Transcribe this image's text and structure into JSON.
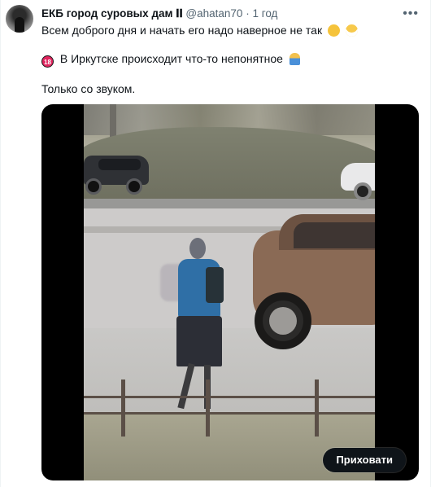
{
  "tweet": {
    "author_name": "ЕКБ город суровых дам 𝐈𝐈",
    "handle": "@ahatan70",
    "separator": "·",
    "time": "1 год",
    "line1": "Всем доброго дня и начать его надо наверное не так",
    "line2": "В Иркутске происходит что-то непонятное",
    "line3": "Только со звуком.",
    "age_badge": "18"
  },
  "media": {
    "hide_button_label": "Приховати"
  },
  "icons": {
    "more": "more-icon",
    "age": "18-plus-icon",
    "wink": "winking-face-icon",
    "grin": "grinning-face-icon",
    "shrug": "person-shrugging-icon"
  },
  "colors": {
    "text": "#0f1419",
    "secondary": "#536471",
    "button_bg": "#0f1419"
  }
}
